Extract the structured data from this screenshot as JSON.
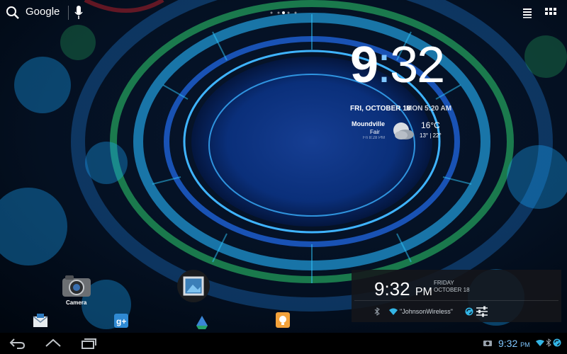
{
  "topbar": {
    "search_label": "Google"
  },
  "clock_widget": {
    "hour": "9",
    "colon": ":",
    "minute": "32",
    "date": "FRI, OCTOBER 18",
    "alarm": "MON 5:20 AM",
    "weather": {
      "city": "Moundville",
      "condition": "Fair",
      "updated": "Fri 8:28 PM",
      "temp": "16°C",
      "range": "13° | 22°"
    }
  },
  "home": {
    "camera_label": "Camera"
  },
  "quick_panel": {
    "time": "9:32",
    "ampm": "PM",
    "day": "FRIDAY",
    "date": "OCTOBER 18",
    "wifi_name": "\"JohnsonWireless\""
  },
  "statusbar": {
    "time": "9:32",
    "ampm": "PM"
  },
  "colors": {
    "accent": "#33b5e5",
    "clock_blue": "#7fc6ff",
    "wallpaper_core": "#0a2f7a"
  },
  "icons": [
    "search-icon",
    "mic-icon",
    "widgets-icon",
    "apps-icon",
    "alarm-icon",
    "weather-icon",
    "camera-icon",
    "gallery-icon",
    "email-icon",
    "gplus-icon",
    "drive-icon",
    "keep-icon",
    "bluetooth-icon",
    "wifi-icon",
    "sync-icon",
    "settings-icon",
    "back-icon",
    "home-icon",
    "recent-icon"
  ]
}
